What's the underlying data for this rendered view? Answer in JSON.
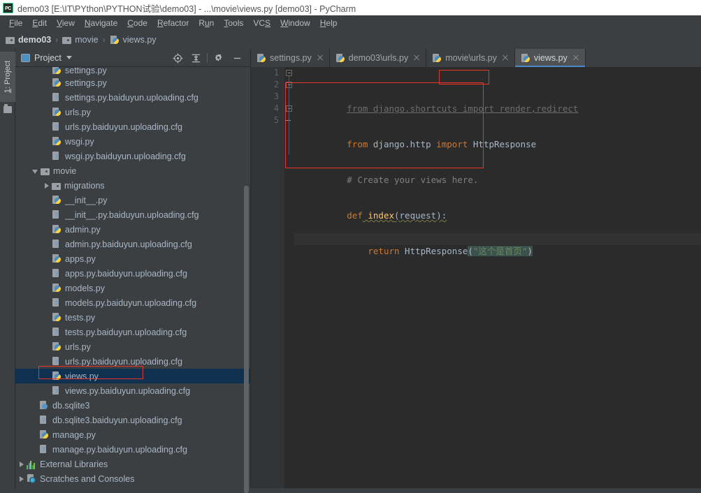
{
  "window": {
    "logo_text": "PC",
    "title": "demo03 [E:\\IT\\PYthon\\PYTHON试验\\demo03] - ...\\movie\\views.py [demo03] - PyCharm"
  },
  "menubar": {
    "items": [
      {
        "label": "File",
        "mnemonic": "F"
      },
      {
        "label": "Edit",
        "mnemonic": "E"
      },
      {
        "label": "View",
        "mnemonic": "V"
      },
      {
        "label": "Navigate",
        "mnemonic": "N"
      },
      {
        "label": "Code",
        "mnemonic": "C"
      },
      {
        "label": "Refactor",
        "mnemonic": "R"
      },
      {
        "label": "Run",
        "mnemonic": "u"
      },
      {
        "label": "Tools",
        "mnemonic": "T"
      },
      {
        "label": "VCS",
        "mnemonic": "S"
      },
      {
        "label": "Window",
        "mnemonic": "W"
      },
      {
        "label": "Help",
        "mnemonic": "H"
      }
    ]
  },
  "breadcrumb": {
    "separator": "›",
    "items": [
      {
        "label": "demo03",
        "icon": "folder-icon"
      },
      {
        "label": "movie",
        "icon": "folder-icon"
      },
      {
        "label": "views.py",
        "icon": "python-file-icon"
      }
    ]
  },
  "left_toolstrip": {
    "tab_label": "1: Project",
    "tab_mnemonic": "1",
    "folder_icon": "folder-icon"
  },
  "project_panel": {
    "title": "Project",
    "title_icon": "project-icon",
    "dropdown_icon": "chevron-down-icon",
    "tools": [
      {
        "name": "locate-icon",
        "title": "Select Opened File"
      },
      {
        "name": "collapse-all-icon",
        "title": "Collapse All"
      },
      {
        "name": "gear-icon",
        "title": "Settings"
      },
      {
        "name": "minimize-icon",
        "title": "Hide"
      }
    ],
    "tree": [
      {
        "label": "settings.py",
        "icon": "python-file-icon",
        "indent": 3,
        "arrow": "none",
        "clipped": true
      },
      {
        "label": "settings.py",
        "icon": "python-file-icon",
        "indent": 3,
        "arrow": "none"
      },
      {
        "label": "settings.py.baiduyun.uploading.cfg",
        "icon": "unknown-file-icon",
        "indent": 3,
        "arrow": "none"
      },
      {
        "label": "urls.py",
        "icon": "python-file-icon",
        "indent": 3,
        "arrow": "none"
      },
      {
        "label": "urls.py.baiduyun.uploading.cfg",
        "icon": "unknown-file-icon",
        "indent": 3,
        "arrow": "none"
      },
      {
        "label": "wsgi.py",
        "icon": "python-file-icon",
        "indent": 3,
        "arrow": "none"
      },
      {
        "label": "wsgi.py.baiduyun.uploading.cfg",
        "icon": "unknown-file-icon",
        "indent": 3,
        "arrow": "none"
      },
      {
        "label": "movie",
        "icon": "folder-icon",
        "indent": 2,
        "arrow": "open"
      },
      {
        "label": "migrations",
        "icon": "folder-icon",
        "indent": 3,
        "arrow": "closed"
      },
      {
        "label": "__init__.py",
        "icon": "python-file-icon",
        "indent": 3,
        "arrow": "none"
      },
      {
        "label": "__init__.py.baiduyun.uploading.cfg",
        "icon": "unknown-file-icon",
        "indent": 3,
        "arrow": "none"
      },
      {
        "label": "admin.py",
        "icon": "python-file-icon",
        "indent": 3,
        "arrow": "none"
      },
      {
        "label": "admin.py.baiduyun.uploading.cfg",
        "icon": "unknown-file-icon",
        "indent": 3,
        "arrow": "none"
      },
      {
        "label": "apps.py",
        "icon": "python-file-icon",
        "indent": 3,
        "arrow": "none"
      },
      {
        "label": "apps.py.baiduyun.uploading.cfg",
        "icon": "unknown-file-icon",
        "indent": 3,
        "arrow": "none"
      },
      {
        "label": "models.py",
        "icon": "python-file-icon",
        "indent": 3,
        "arrow": "none"
      },
      {
        "label": "models.py.baiduyun.uploading.cfg",
        "icon": "unknown-file-icon",
        "indent": 3,
        "arrow": "none"
      },
      {
        "label": "tests.py",
        "icon": "python-file-icon",
        "indent": 3,
        "arrow": "none"
      },
      {
        "label": "tests.py.baiduyun.uploading.cfg",
        "icon": "unknown-file-icon",
        "indent": 3,
        "arrow": "none"
      },
      {
        "label": "urls.py",
        "icon": "python-file-icon",
        "indent": 3,
        "arrow": "none"
      },
      {
        "label": "urls.py.baiduyun.uploading.cfg",
        "icon": "unknown-file-icon",
        "indent": 3,
        "arrow": "none"
      },
      {
        "label": "views.py",
        "icon": "python-file-icon",
        "indent": 3,
        "arrow": "none",
        "selected": true,
        "highlighted": true
      },
      {
        "label": "views.py.baiduyun.uploading.cfg",
        "icon": "unknown-file-icon",
        "indent": 3,
        "arrow": "none"
      },
      {
        "label": "db.sqlite3",
        "icon": "database-file-icon",
        "indent": 2,
        "arrow": "none"
      },
      {
        "label": "db.sqlite3.baiduyun.uploading.cfg",
        "icon": "unknown-file-icon",
        "indent": 2,
        "arrow": "none"
      },
      {
        "label": "manage.py",
        "icon": "python-file-icon",
        "indent": 2,
        "arrow": "none"
      },
      {
        "label": "manage.py.baiduyun.uploading.cfg",
        "icon": "unknown-file-icon",
        "indent": 2,
        "arrow": "none"
      },
      {
        "label": "External Libraries",
        "icon": "libraries-icon",
        "indent": 1,
        "arrow": "closed"
      },
      {
        "label": "Scratches and Consoles",
        "icon": "scratches-icon",
        "indent": 1,
        "arrow": "closed"
      }
    ]
  },
  "editor": {
    "tabs": [
      {
        "label": "settings.py",
        "icon": "python-file-icon",
        "active": false,
        "close_icon": "close-icon"
      },
      {
        "label": "demo03\\urls.py",
        "icon": "python-file-icon",
        "active": false,
        "close_icon": "close-icon"
      },
      {
        "label": "movie\\urls.py",
        "icon": "python-file-icon",
        "active": false,
        "close_icon": "close-icon"
      },
      {
        "label": "views.py",
        "icon": "python-file-icon",
        "active": true,
        "close_icon": "close-icon"
      }
    ],
    "line_numbers": [
      "1",
      "2",
      "3",
      "4",
      "5"
    ],
    "lines": [
      {
        "n": "1",
        "text": "from django.shortcuts import render,redirect",
        "state": "unused-import"
      },
      {
        "n": "2",
        "text": "from django.http import HttpResponse",
        "state": "normal"
      },
      {
        "n": "3",
        "text": "# Create your views here.",
        "state": "comment"
      },
      {
        "n": "4",
        "text": "def index(request):",
        "state": "normal"
      },
      {
        "n": "5",
        "text": "    return HttpResponse(\"这个是首页\")",
        "state": "current"
      }
    ],
    "code_tokens": {
      "l1_full": "from django.shortcuts import render,redirect",
      "l2_from": "from",
      "l2_mod": " django.http ",
      "l2_import": "import",
      "l2_cls": " HttpResponse",
      "l3_comment": "# Create your views here.",
      "l4_def": "def",
      "l4_name": " index",
      "l4_rest": "(request):",
      "l5_indent": "    ",
      "l5_return": "return",
      "l5_call": " HttpResponse",
      "l5_open": "(",
      "l5_str": "\"这个是首页\"",
      "l5_close": ")"
    }
  },
  "annotations": {
    "color": "#e8342a",
    "boxes": [
      {
        "name": "redirect-highlight",
        "label": "redirect"
      },
      {
        "name": "code-block-highlight",
        "label": "lines 2-5"
      },
      {
        "name": "views-py-tree-highlight",
        "label": "views.py"
      }
    ]
  }
}
